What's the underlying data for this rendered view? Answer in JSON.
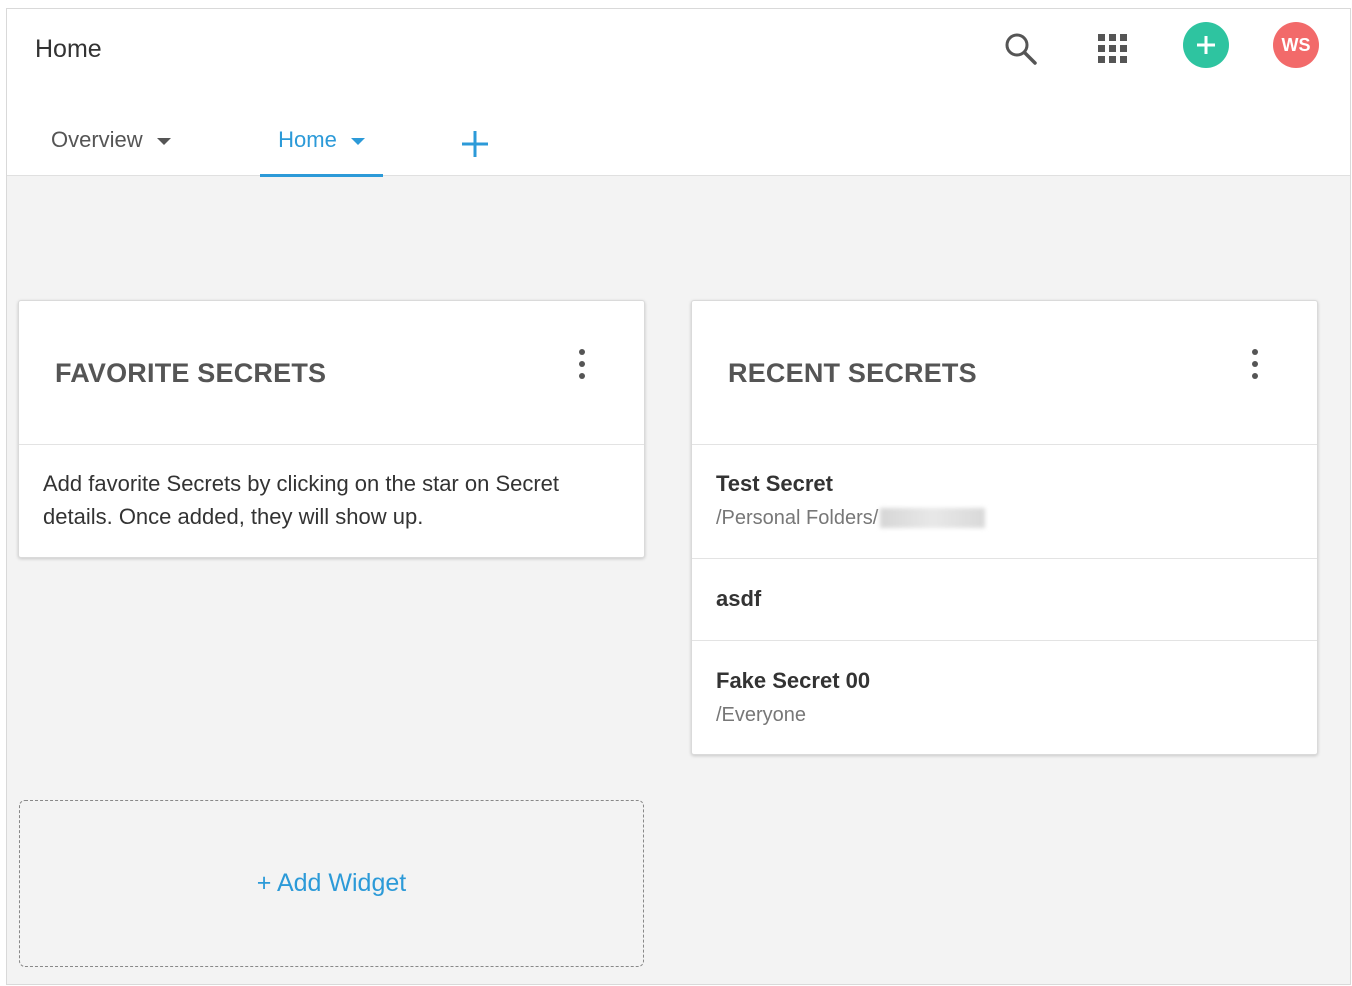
{
  "header": {
    "title": "Home",
    "icons": [
      "search-icon",
      "apps-grid-icon",
      "add-icon"
    ],
    "avatar_initials": "WS",
    "colors": {
      "add_button": "#2ec4a0",
      "avatar": "#f26a6a",
      "accent": "#2c9ad8"
    }
  },
  "tabs": [
    {
      "label": "Overview",
      "active": false
    },
    {
      "label": "Home",
      "active": true
    }
  ],
  "favorite_secrets": {
    "title": "FAVORITE SECRETS",
    "message": "Add favorite Secrets by clicking on the star on Secret details. Once added, they will show up."
  },
  "recent_secrets": {
    "title": "RECENT SECRETS",
    "items": [
      {
        "name": "Test Secret",
        "path": "/Personal Folders/"
      },
      {
        "name": "asdf",
        "path": ""
      },
      {
        "name": "Fake Secret 00",
        "path": "/Everyone"
      }
    ]
  },
  "add_widget": {
    "label": "+ Add Widget"
  }
}
